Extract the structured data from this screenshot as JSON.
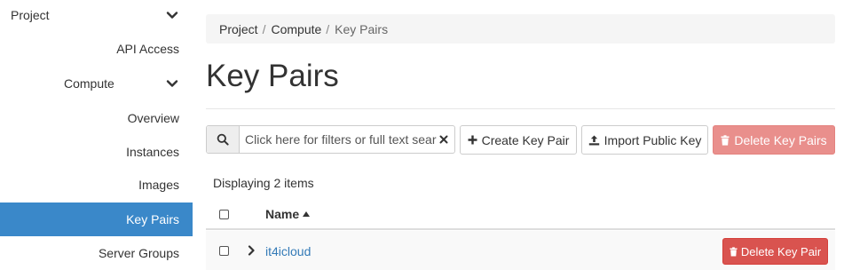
{
  "sidebar": {
    "project": "Project",
    "api_access": "API Access",
    "compute": "Compute",
    "overview": "Overview",
    "instances": "Instances",
    "images": "Images",
    "key_pairs": "Key Pairs",
    "server_groups": "Server Groups"
  },
  "breadcrumb": {
    "items": [
      "Project",
      "Compute",
      "Key Pairs"
    ],
    "separator": "/"
  },
  "page_title": "Key Pairs",
  "toolbar": {
    "search_placeholder": "Click here for filters or full text search",
    "create_label": "Create Key Pair",
    "import_label": "Import Public Key",
    "delete_all_label": "Delete Key Pairs"
  },
  "table": {
    "count_text": "Displaying 2 items",
    "name_header": "Name",
    "rows": [
      {
        "name": "it4icloud",
        "delete_label": "Delete Key Pair"
      }
    ]
  },
  "colors": {
    "active_nav": "#3a88c9",
    "link": "#337ab7",
    "danger": "#d9534f",
    "danger_disabled": "#e98f8c"
  }
}
